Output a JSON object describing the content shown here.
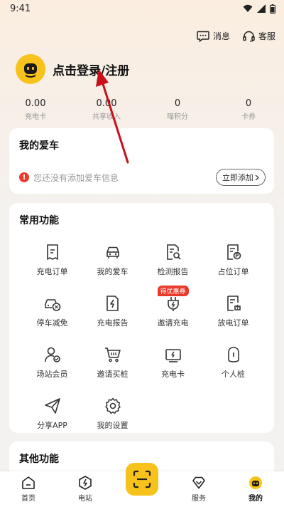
{
  "status": {
    "time": "9:41"
  },
  "header": {
    "messages_label": "消息",
    "service_label": "客服"
  },
  "profile": {
    "login_label": "点击登录/注册"
  },
  "stats": [
    {
      "value": "0.00",
      "label": "充电卡"
    },
    {
      "value": "0.00",
      "label": "共享收入"
    },
    {
      "value": "0",
      "label": "喵积分"
    },
    {
      "value": "0",
      "label": "卡券"
    }
  ],
  "my_car": {
    "title": "我的爱车",
    "empty_message": "您还没有添加爱车信息",
    "add_label": "立即添加"
  },
  "common_functions": {
    "title": "常用功能",
    "items": [
      {
        "label": "充电订单",
        "icon": "order-icon"
      },
      {
        "label": "我的爱车",
        "icon": "car-icon"
      },
      {
        "label": "检测报告",
        "icon": "report-search-icon"
      },
      {
        "label": "占位订单",
        "icon": "parking-order-icon"
      },
      {
        "label": "停车减免",
        "icon": "parking-discount-icon"
      },
      {
        "label": "充电报告",
        "icon": "charge-report-icon"
      },
      {
        "label": "邀请充电",
        "icon": "plug-icon",
        "badge": "得优惠券"
      },
      {
        "label": "放电订单",
        "icon": "discharge-order-icon"
      },
      {
        "label": "场站会员",
        "icon": "member-icon"
      },
      {
        "label": "邀请买桩",
        "icon": "cart-icon"
      },
      {
        "label": "充电卡",
        "icon": "charge-card-icon"
      },
      {
        "label": "个人桩",
        "icon": "personal-pile-icon"
      },
      {
        "label": "分享APP",
        "icon": "share-icon"
      },
      {
        "label": "我的设置",
        "icon": "settings-icon"
      }
    ]
  },
  "other_functions": {
    "title": "其他功能"
  },
  "tabs": [
    {
      "label": "首页",
      "icon": "home-icon"
    },
    {
      "label": "电站",
      "icon": "station-icon"
    },
    {
      "label": "服务",
      "icon": "service-icon"
    },
    {
      "label": "我的",
      "icon": "mine-icon"
    }
  ],
  "colors": {
    "accent": "#F7C21B",
    "warning": "#E83A2E",
    "badge": "#E8392B"
  }
}
